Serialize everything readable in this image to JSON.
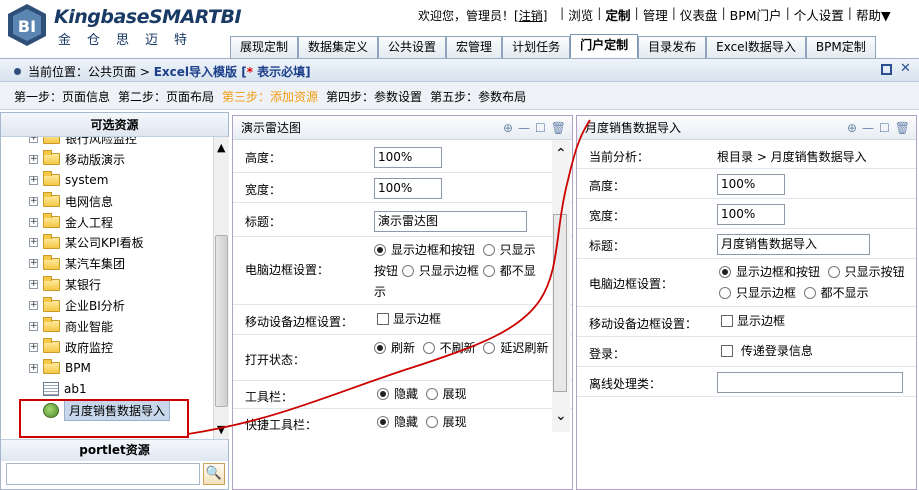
{
  "header": {
    "brand": "KingbaseSMARTBI",
    "brand_cn": "金仓思迈特",
    "welcome_prefix": "欢迎您，管理员！[",
    "logout": "注销",
    "welcome_suffix": "]",
    "links": [
      "浏览",
      "定制",
      "管理",
      "仪表盘",
      "BPM门户",
      "个人设置",
      "帮助▼"
    ],
    "active_link": "定制"
  },
  "tabs": [
    "展现定制",
    "数据集定义",
    "公共设置",
    "宏管理",
    "计划任务",
    "门户定制",
    "目录发布",
    "Excel数据导入",
    "BPM定制"
  ],
  "active_tab": "门户定制",
  "location": {
    "prefix": "当前位置：",
    "page": "公共页面 > ",
    "title": "Excel导入模版",
    "req_open": " [",
    "req_star": "*",
    "req_text": " 表示必填]"
  },
  "steps": [
    "第一步：页面信息",
    "第二步：页面布局",
    "第三步：添加资源",
    "第四步：参数设置",
    "第五步：参数布局"
  ],
  "current_step": "第三步：添加资源",
  "left_panel": {
    "title": "可选资源",
    "tree": [
      {
        "label": "银行风险监控",
        "type": "folder"
      },
      {
        "label": "移动版演示",
        "type": "folder"
      },
      {
        "label": "system",
        "type": "folder"
      },
      {
        "label": "电网信息",
        "type": "folder"
      },
      {
        "label": "金人工程",
        "type": "folder"
      },
      {
        "label": "某公司KPI看板",
        "type": "folder"
      },
      {
        "label": "某汽车集团",
        "type": "folder"
      },
      {
        "label": "某银行",
        "type": "folder"
      },
      {
        "label": "企业BI分析",
        "type": "folder"
      },
      {
        "label": "商业智能",
        "type": "folder"
      },
      {
        "label": "政府监控",
        "type": "folder"
      },
      {
        "label": "BPM",
        "type": "folder"
      },
      {
        "label": "ab1",
        "type": "doc"
      },
      {
        "label": "月度销售数据导入",
        "type": "import",
        "selected": true
      }
    ],
    "portlet_title": "portlet资源",
    "search_value": ""
  },
  "panel1": {
    "title": "演示雷达图",
    "height_label": "高度：",
    "height_value": "100%",
    "width_label": "宽度：",
    "width_value": "100%",
    "title_label": "标题：",
    "title_value": "演示雷达图",
    "pc_border_label": "电脑边框设置：",
    "pc_border_opts": [
      "显示边框和按钮",
      "只显示按钮",
      "只显示边框",
      "都不显示"
    ],
    "mobile_border_label": "移动设备边框设置：",
    "mobile_border_opt": "显示边框",
    "open_state_label": "打开状态：",
    "open_state_opts": [
      "刷新",
      "不刷新",
      "延迟刷新"
    ],
    "toolbar_label": "工具栏：",
    "toolbar_opts": [
      "隐藏",
      "展现"
    ],
    "quick_toolbar_label": "快捷工具栏：",
    "quick_toolbar_opts": [
      "隐藏",
      "展现"
    ]
  },
  "panel2": {
    "title": "月度销售数据导入",
    "analysis_label": "当前分析：",
    "analysis_value": "根目录 > 月度销售数据导入",
    "height_label": "高度：",
    "height_value": "100%",
    "width_label": "宽度：",
    "width_value": "100%",
    "title_label": "标题：",
    "title_value": "月度销售数据导入",
    "pc_border_label": "电脑边框设置：",
    "pc_border_opts": [
      "显示边框和按钮",
      "只显示按钮",
      "只显示边框",
      "都不显示"
    ],
    "mobile_border_label": "移动设备边框设置：",
    "mobile_border_opt": "显示边框",
    "login_label": "登录：",
    "login_opt": "传递登录信息",
    "offline_label": "离线处理类：",
    "offline_value": ""
  },
  "colors": {
    "accent": "#1c3f8a",
    "current_step": "#f39c12",
    "annotation": "#cc0000"
  }
}
